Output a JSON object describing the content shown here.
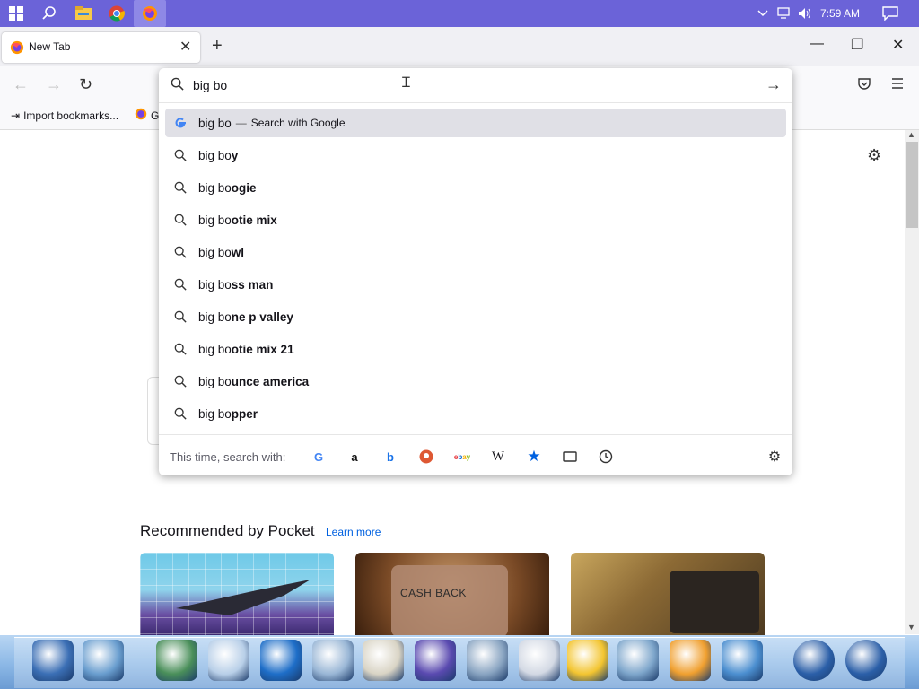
{
  "taskbar": {
    "icons": [
      "windows-start-icon",
      "search-icon",
      "file-explorer-icon",
      "chrome-icon",
      "firefox-icon"
    ],
    "tray": [
      "chevron-up-icon",
      "network-icon",
      "volume-icon"
    ],
    "clock": "7:59 AM",
    "accent": "#6b63d8"
  },
  "browser": {
    "tab_title": "New Tab",
    "bookmarks": {
      "import_label": "Import bookmarks...",
      "partial_label": "G"
    },
    "url_value": "big bo"
  },
  "suggestions": {
    "first": {
      "typed": "big bo",
      "dash": "—",
      "action": "Search with Google"
    },
    "items": [
      {
        "prefix": "big bo",
        "rest": "y"
      },
      {
        "prefix": "big bo",
        "rest": "ogie"
      },
      {
        "prefix": "big bo",
        "rest": "otie mix"
      },
      {
        "prefix": "big bo",
        "rest": "wl"
      },
      {
        "prefix": "big bo",
        "rest": "ss man"
      },
      {
        "prefix": "big bo",
        "rest": "ne p valley"
      },
      {
        "prefix": "big bo",
        "rest": "otie mix 21"
      },
      {
        "prefix": "big bo",
        "rest": "unce america"
      },
      {
        "prefix": "big bo",
        "rest": "pper"
      }
    ],
    "oneoff_label": "This time, search with:",
    "engines": [
      "google-icon",
      "amazon-icon",
      "bing-icon",
      "duckduckgo-icon",
      "ebay-icon",
      "wikipedia-icon",
      "bookmarks-star-icon",
      "tabs-icon",
      "history-icon"
    ]
  },
  "pocket": {
    "title": "Recommended by Pocket",
    "learn_more": "Learn more",
    "card2_text": "CASH BACK"
  },
  "dock": {
    "items": [
      "key-icon",
      "trash-icon",
      "network-computer-icon",
      "mail-icon",
      "internet-explorer-icon",
      "search-magnifier-icon",
      "rtf-document-icon",
      "cube-icon",
      "disk-icon",
      "folder-clock-icon",
      "sun-settings-icon",
      "music-icon",
      "media-player-icon",
      "paint-icon",
      "power-icon",
      "shutdown-icon"
    ]
  }
}
